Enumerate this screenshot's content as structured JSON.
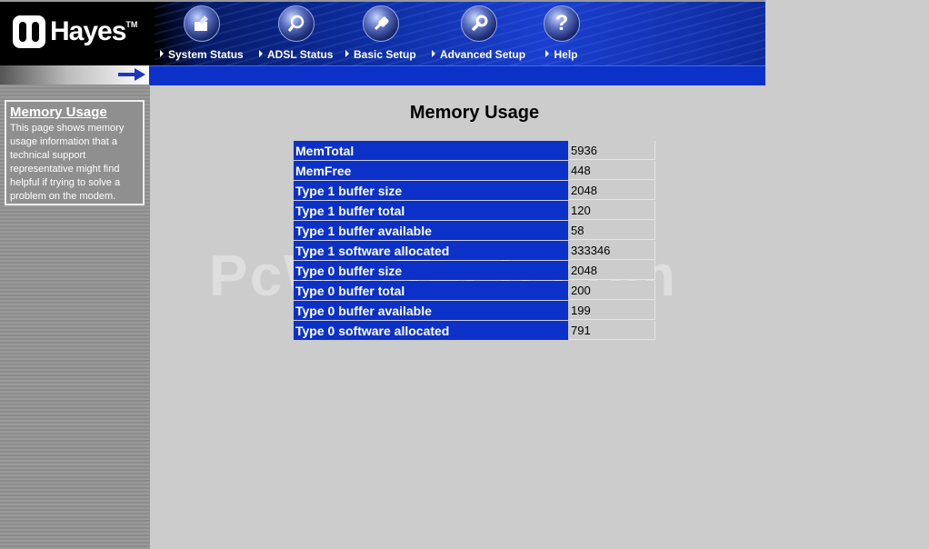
{
  "brand": {
    "name": "Hayes",
    "tm": "TM"
  },
  "nav": [
    {
      "label": "System Status",
      "icon": "system-status-icon"
    },
    {
      "label": "ADSL Status",
      "icon": "magnifier-icon"
    },
    {
      "label": "Basic Setup",
      "icon": "plug-icon"
    },
    {
      "label": "Advanced Setup",
      "icon": "wrench-icon"
    },
    {
      "label": "Help",
      "icon": "question-icon",
      "glyph": "?"
    }
  ],
  "sidebar": {
    "title": "Memory Usage",
    "text": "This page shows memory usage information that a technical support representative might find helpful if trying to solve a problem on the modem."
  },
  "main": {
    "title": "Memory Usage",
    "rows": [
      {
        "label": "MemTotal",
        "value": "5936"
      },
      {
        "label": "MemFree",
        "value": "448"
      },
      {
        "label": "Type 1 buffer size",
        "value": "2048"
      },
      {
        "label": "Type 1 buffer total",
        "value": "120"
      },
      {
        "label": "Type 1 buffer available",
        "value": "58"
      },
      {
        "label": "Type 1 software allocated",
        "value": "333346"
      },
      {
        "label": "Type 0 buffer size",
        "value": "2048"
      },
      {
        "label": "Type 0 buffer total",
        "value": "200"
      },
      {
        "label": "Type 0 buffer available",
        "value": "199"
      },
      {
        "label": "Type 0 software allocated",
        "value": "791"
      }
    ]
  },
  "watermark": "PcWinTech.com",
  "colors": {
    "accent": "#0b31c8",
    "background": "#cccccc"
  }
}
